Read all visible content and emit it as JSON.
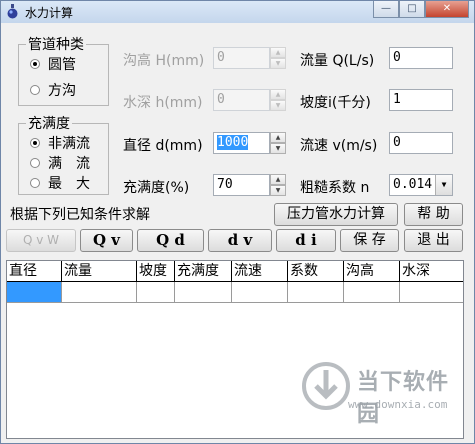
{
  "window": {
    "title": "水力计算",
    "minimize_glyph": "—",
    "maximize_glyph": "□",
    "close_glyph": "✕"
  },
  "pipe_type_group": {
    "label": "管道种类",
    "options": [
      "圆管",
      "方沟"
    ],
    "selected": "圆管"
  },
  "fullness_group": {
    "label": "充满度",
    "options": [
      "非满流",
      "满　流",
      "最　大"
    ],
    "selected": "非满流"
  },
  "fields": {
    "trench_height": {
      "label": "沟高 H(mm)",
      "value": "0"
    },
    "water_depth": {
      "label": "水深 h(mm)",
      "value": "0"
    },
    "diameter": {
      "label": "直径 d(mm)",
      "value": "1000"
    },
    "fullness": {
      "label": "充满度(%)",
      "value": "70"
    },
    "flow": {
      "label": "流量 Q(L/s)",
      "value": "0"
    },
    "slope": {
      "label": "坡度i(千分)",
      "value": "1"
    },
    "velocity": {
      "label": "流速 v(m/s)",
      "value": "0"
    },
    "roughness": {
      "label": "粗糙系数 n",
      "value": "0.014"
    }
  },
  "hint_text": "根据下列已知条件求解",
  "buttons": {
    "pressure_pipe": "压力管水力计算",
    "help": "帮 助",
    "qvw": "Q v W",
    "qv": "Q v",
    "qd": "Q d",
    "dv": "d v",
    "di": "d i",
    "save": "保 存",
    "exit": "退 出"
  },
  "table": {
    "columns": [
      "直径",
      "流量",
      "坡度",
      "充满度",
      "流速",
      "系数",
      "沟高",
      "水深"
    ]
  },
  "watermark": {
    "brand": "当下软件园",
    "url": "www.downxia.com"
  }
}
